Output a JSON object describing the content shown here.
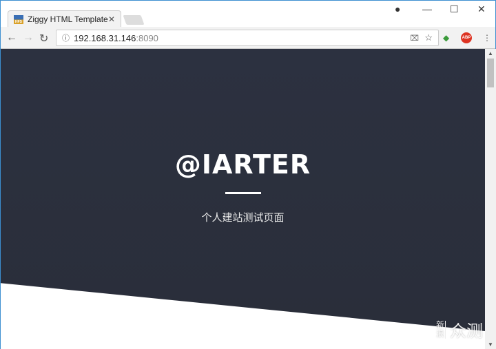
{
  "browser": {
    "tab_title": "Ziggy HTML Template",
    "url_host": "192.168.31.146",
    "url_port": ":8090",
    "favicon_text": "HFS"
  },
  "hero": {
    "title": "@IARTER",
    "subtitle": "个人建站测试页面",
    "background": "#2b303d"
  },
  "watermark": {
    "small": "新浪",
    "large": "众测"
  }
}
